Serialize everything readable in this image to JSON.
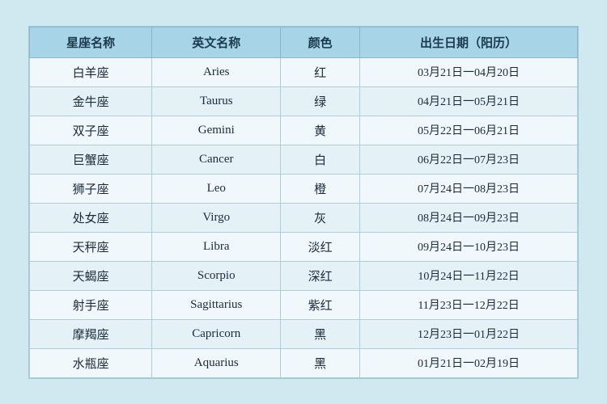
{
  "table": {
    "headers": [
      "星座名称",
      "英文名称",
      "颜色",
      "出生日期（阳历）"
    ],
    "rows": [
      {
        "chinese": "白羊座",
        "english": "Aries",
        "color": "红",
        "dates": "03月21日一04月20日"
      },
      {
        "chinese": "金牛座",
        "english": "Taurus",
        "color": "绿",
        "dates": "04月21日一05月21日"
      },
      {
        "chinese": "双子座",
        "english": "Gemini",
        "color": "黄",
        "dates": "05月22日一06月21日"
      },
      {
        "chinese": "巨蟹座",
        "english": "Cancer",
        "color": "白",
        "dates": "06月22日一07月23日"
      },
      {
        "chinese": "狮子座",
        "english": "Leo",
        "color": "橙",
        "dates": "07月24日一08月23日"
      },
      {
        "chinese": "处女座",
        "english": "Virgo",
        "color": "灰",
        "dates": "08月24日一09月23日"
      },
      {
        "chinese": "天秤座",
        "english": "Libra",
        "color": "淡红",
        "dates": "09月24日一10月23日"
      },
      {
        "chinese": "天蝎座",
        "english": "Scorpio",
        "color": "深红",
        "dates": "10月24日一11月22日"
      },
      {
        "chinese": "射手座",
        "english": "Sagittarius",
        "color": "紫红",
        "dates": "11月23日一12月22日"
      },
      {
        "chinese": "摩羯座",
        "english": "Capricorn",
        "color": "黑",
        "dates": "12月23日一01月22日"
      },
      {
        "chinese": "水瓶座",
        "english": "Aquarius",
        "color": "黑",
        "dates": "01月21日一02月19日"
      }
    ]
  }
}
